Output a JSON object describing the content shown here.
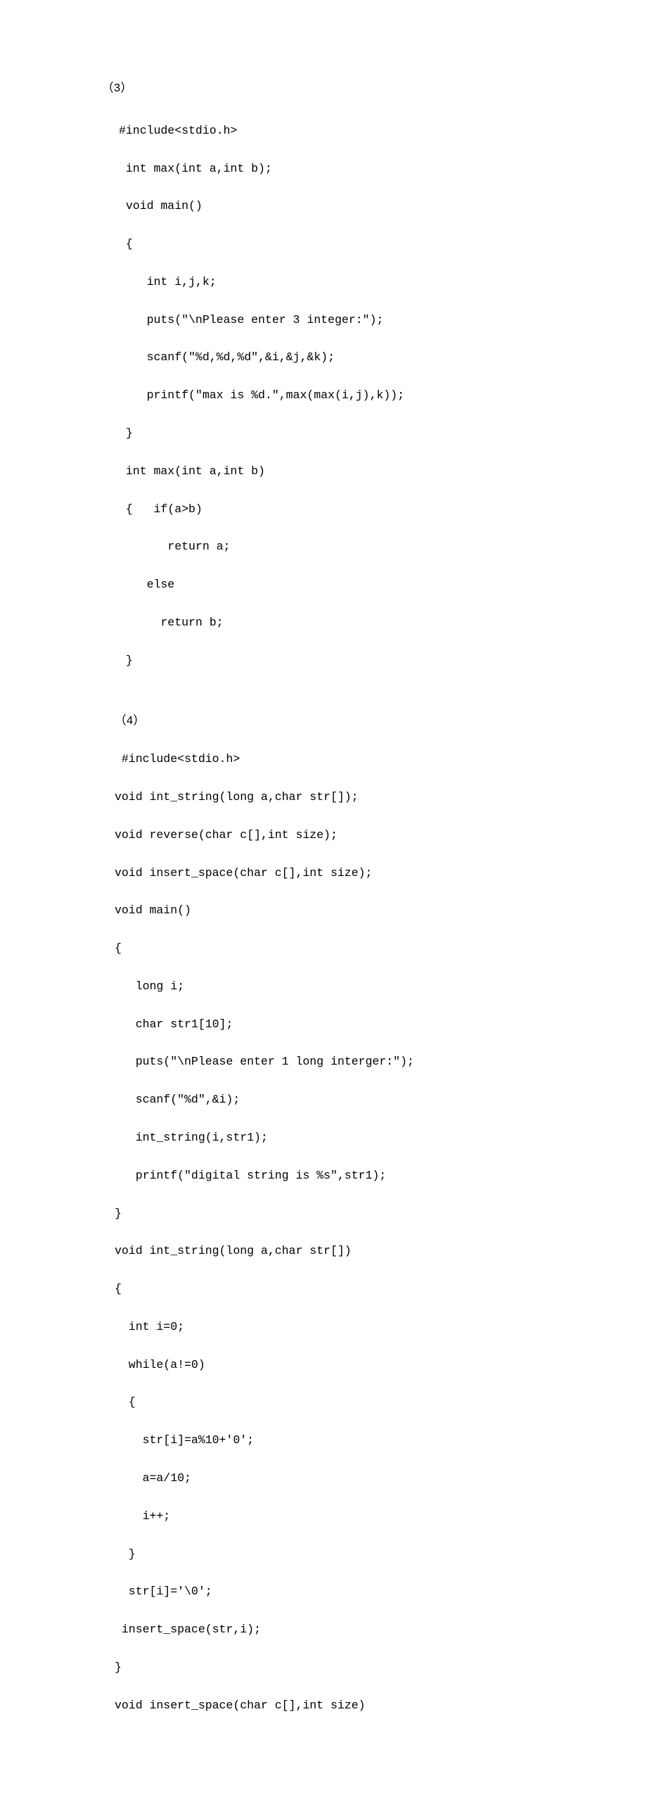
{
  "labels": {
    "sec3": "（3）",
    "sec4": "（4）"
  },
  "code3": {
    "l01": "#include<stdio.h>",
    "l02": " int max(int a,int b);",
    "l03": " void main()",
    "l04": " {",
    "l05": "    int i,j,k;",
    "l06": "    puts(\"\\nPlease enter 3 integer:\");",
    "l07": "    scanf(\"%d,%d,%d\",&i,&j,&k);",
    "l08": "    printf(\"max is %d.\",max(max(i,j),k));",
    "l09": " }",
    "l10": " int max(int a,int b)",
    "l11": " {   if(a>b)",
    "l12": "       return a;",
    "l13": "    else",
    "l14": "      return b;",
    "l15": " }"
  },
  "code4": {
    "l01": " #include<stdio.h>",
    "l02": "void int_string(long a,char str[]);",
    "l03": "void reverse(char c[],int size);",
    "l04": "void insert_space(char c[],int size);",
    "l05": "void main()",
    "l06": "{",
    "l07": "   long i;",
    "l08": "   char str1[10];",
    "l09": "   puts(\"\\nPlease enter 1 long interger:\");",
    "l10": "   scanf(\"%d\",&i);",
    "l11": "   int_string(i,str1);",
    "l12": "   printf(\"digital string is %s\",str1);",
    "l13": "}",
    "l14": "void int_string(long a,char str[])",
    "l15": "{",
    "l16": "  int i=0;",
    "l17": "  while(a!=0)",
    "l18": "  {",
    "l19": "    str[i]=a%10+'0';",
    "l20": "    a=a/10;",
    "l21": "    i++;",
    "l22": "  }",
    "l23": "  str[i]='\\0';",
    "l24": " insert_space(str,i);",
    "l25": "}",
    "l26": "void insert_space(char c[],int size)"
  }
}
